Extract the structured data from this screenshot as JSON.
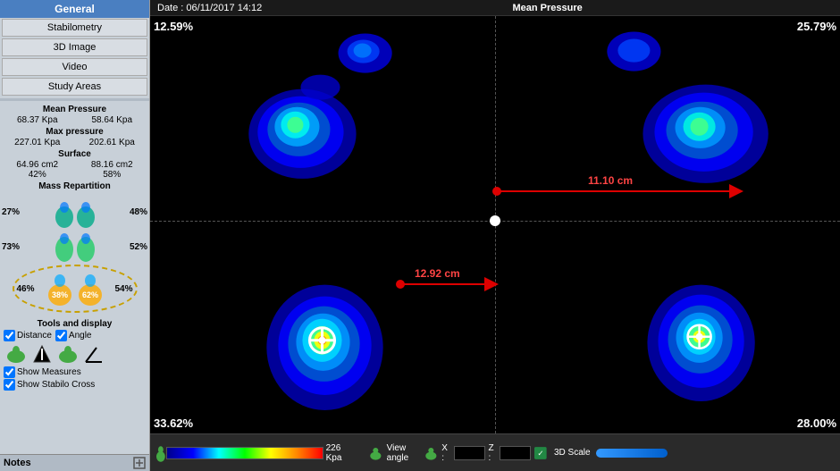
{
  "sidebar": {
    "header": "General",
    "buttons": [
      "Stabilometry",
      "3D Image",
      "Video",
      "Study Areas"
    ],
    "sections": {
      "mean_pressure": {
        "title": "Mean Pressure",
        "left": "68.37 Kpa",
        "right": "58.64 Kpa"
      },
      "max_pressure": {
        "title": "Max pressure",
        "left": "227.01 Kpa",
        "right": "202.61 Kpa"
      },
      "surface": {
        "title": "Surface",
        "left_cm2": "64.96 cm2",
        "right_cm2": "88.16 cm2",
        "left_pct": "42%",
        "right_pct": "58%"
      },
      "mass_repartition": {
        "title": "Mass Repartition",
        "top_left": "27%",
        "top_right": "48%",
        "mid_left": "73%",
        "mid_right": "52%",
        "bot_left": "46%",
        "bot_mid_left": "38%",
        "bot_mid_right": "62%",
        "bot_right": "54%"
      }
    },
    "tools": {
      "title": "Tools and display",
      "distance_checked": true,
      "angle_checked": true,
      "show_measures_checked": true,
      "show_stabilo_cross_checked": true,
      "distance_label": "Distance",
      "angle_label": "Angle",
      "show_measures_label": "Show Measures",
      "show_stabilo_label": "Show Stabilo Cross"
    },
    "notes": "Notes"
  },
  "header": {
    "date_label": "Date : 06/11/2017 14:12",
    "title": "Mean Pressure"
  },
  "map": {
    "pct_top_left": "12.59%",
    "pct_top_right": "25.79%",
    "pct_bot_left": "33.62%",
    "pct_bot_right": "28.00%",
    "measure1_label": "11.10 cm",
    "measure2_label": "12.92 cm"
  },
  "bottombar": {
    "scale_kpa": "226 Kpa",
    "view_angle_label": "View angle",
    "x_label": "X :",
    "x_value": "",
    "z_label": "Z :",
    "z_value": "",
    "scale_3d_label": "3D Scale"
  }
}
